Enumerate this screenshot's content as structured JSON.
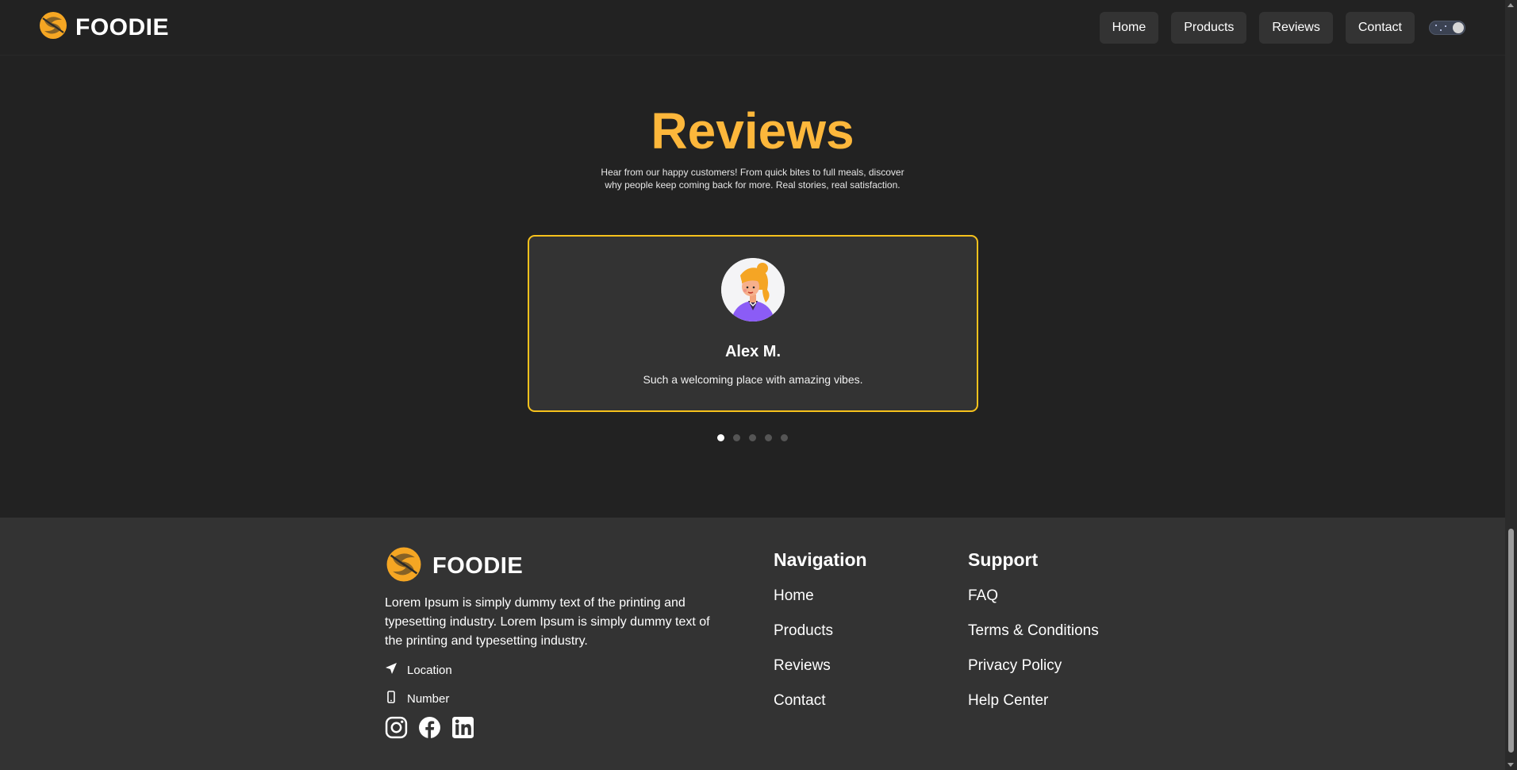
{
  "header": {
    "brand": "FOODIE",
    "nav": [
      "Home",
      "Products",
      "Reviews",
      "Contact"
    ],
    "theme_toggle_icon": "dark-mode-toggle-icon"
  },
  "reviews": {
    "title": "Reviews",
    "subtitle": "Hear from our happy customers! From quick bites to full meals, discover why people keep coming back for more. Real stories, real satisfaction.",
    "active_card": {
      "name": "Alex M.",
      "text": "Such a welcoming place with amazing vibes."
    },
    "pagination": {
      "total": 5,
      "active_index": 0
    }
  },
  "footer": {
    "brand": "FOODIE",
    "description": "Lorem Ipsum is simply dummy text of the printing and typesetting industry. Lorem Ipsum is simply dummy text of the printing and typesetting industry.",
    "location_label": "Location",
    "number_label": "Number",
    "social_icons": [
      "instagram-icon",
      "facebook-icon",
      "linkedin-icon"
    ],
    "navigation": {
      "heading": "Navigation",
      "links": [
        "Home",
        "Products",
        "Reviews",
        "Contact"
      ]
    },
    "support": {
      "heading": "Support",
      "links": [
        "FAQ",
        "Terms & Conditions",
        "Privacy Policy",
        "Help Center"
      ]
    }
  },
  "colors": {
    "background": "#222222",
    "footer_background": "#333333",
    "accent_orange": "#fdb73b",
    "card_border": "#f7c21c"
  }
}
